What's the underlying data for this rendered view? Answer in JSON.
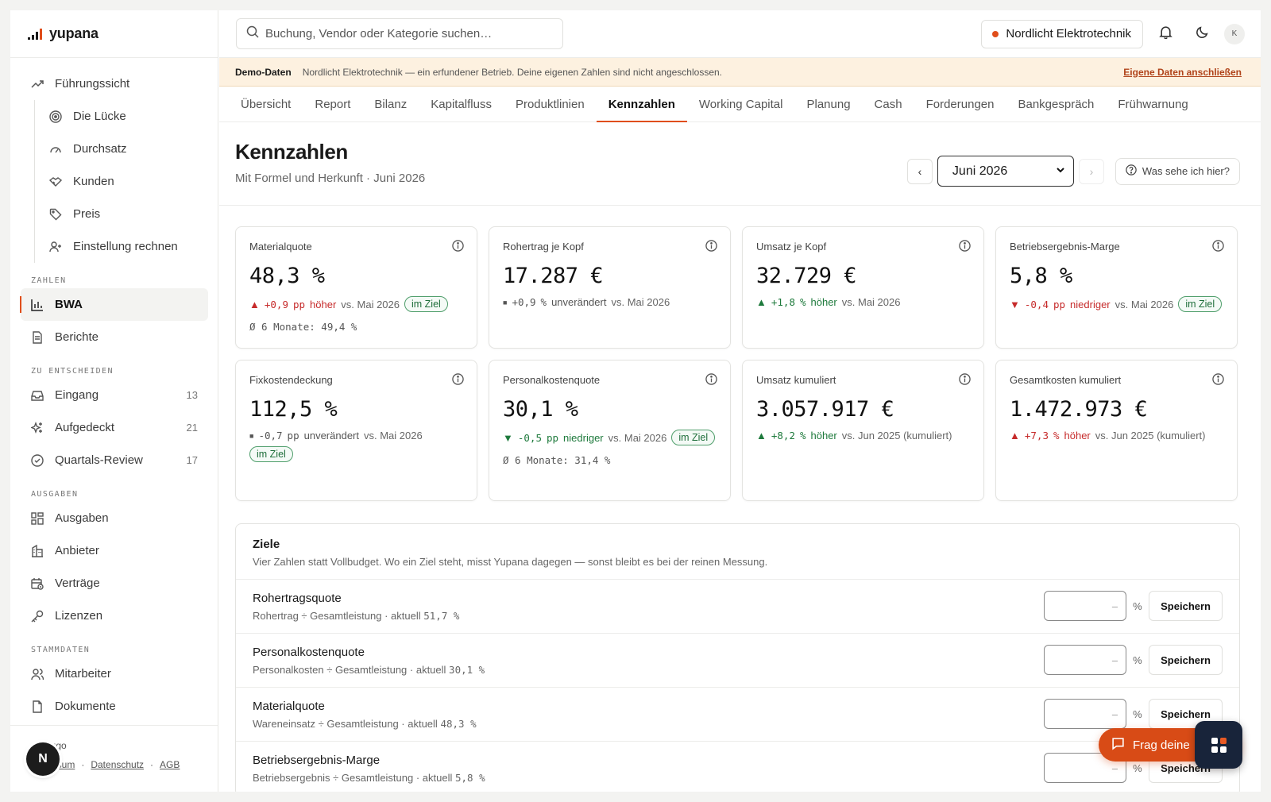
{
  "brand": {
    "name": "yupana"
  },
  "sidebar": {
    "items": [
      {
        "label": "Führungssicht",
        "icon": "trend-up-icon"
      },
      {
        "label": "Die Lücke",
        "icon": "target-icon"
      },
      {
        "label": "Durchsatz",
        "icon": "gauge-icon"
      },
      {
        "label": "Kunden",
        "icon": "handshake-icon"
      },
      {
        "label": "Preis",
        "icon": "tag-icon"
      },
      {
        "label": "Einstellung rechnen",
        "icon": "user-plus-icon"
      },
      {
        "label": "BWA",
        "icon": "bar-chart-icon"
      },
      {
        "label": "Berichte",
        "icon": "document-icon"
      },
      {
        "label": "Eingang",
        "icon": "inbox-icon",
        "count": "13"
      },
      {
        "label": "Aufgedeckt",
        "icon": "sparkles-icon",
        "count": "21"
      },
      {
        "label": "Quartals-Review",
        "icon": "check-circle-icon",
        "count": "17"
      },
      {
        "label": "Ausgaben",
        "icon": "grid-icon"
      },
      {
        "label": "Anbieter",
        "icon": "building-icon"
      },
      {
        "label": "Verträge",
        "icon": "calendar-clock-icon"
      },
      {
        "label": "Lizenzen",
        "icon": "key-icon"
      },
      {
        "label": "Mitarbeiter",
        "icon": "users-icon"
      },
      {
        "label": "Dokumente",
        "icon": "file-icon"
      }
    ],
    "sections": {
      "zahlen": "ZAHLEN",
      "entscheiden": "ZU ENTSCHEIDEN",
      "ausgaben": "AUSGABEN",
      "stammdaten": "STAMMDATEN"
    },
    "footer": {
      "domain": "g.hugo",
      "impressum": "Impressum",
      "datenschutz": "Datenschutz",
      "agb": "AGB",
      "sep": "·"
    },
    "avatar_letter": "N"
  },
  "topbar": {
    "search_placeholder": "Buchung, Vendor oder Kategorie suchen…",
    "company": "Nordlicht Elektrotechnik",
    "user_initial": "K"
  },
  "demo_banner": {
    "label": "Demo-Daten",
    "text": "Nordlicht Elektrotechnik — ein erfundener Betrieb. Deine eigenen Zahlen sind nicht angeschlossen.",
    "link": "Eigene Daten anschließen"
  },
  "tabs": [
    "Übersicht",
    "Report",
    "Bilanz",
    "Kapitalfluss",
    "Produktlinien",
    "Kennzahlen",
    "Working Capital",
    "Planung",
    "Cash",
    "Forderungen",
    "Bankgespräch",
    "Frühwarnung"
  ],
  "page": {
    "title": "Kennzahlen",
    "subtitle": "Mit Formel und Herkunft · Juni 2026",
    "period": "Juni 2026",
    "help": "Was sehe ich hier?"
  },
  "kpis": [
    {
      "label": "Materialquote",
      "value": "48,3 %",
      "arrow": "▲",
      "delta": "+0,9",
      "unit": "pp",
      "dir": "höher",
      "vs": "vs. Mai 2026",
      "badge": "im Ziel",
      "avg": "Ø 6 Monate: 49,4 %"
    },
    {
      "label": "Rohertrag je Kopf",
      "value": "17.287 €",
      "arrow": "■",
      "delta": "+0,9",
      "unit": "%",
      "dir": "unverändert",
      "vs": "vs. Mai 2026"
    },
    {
      "label": "Umsatz je Kopf",
      "value": "32.729 €",
      "arrow": "▲",
      "delta": "+1,8",
      "unit": "%",
      "dir": "höher",
      "vs": "vs. Mai 2026"
    },
    {
      "label": "Betriebsergebnis-Marge",
      "value": "5,8 %",
      "arrow": "▼",
      "delta": "-0,4",
      "unit": "pp",
      "dir": "niedriger",
      "vs": "vs. Mai 2026",
      "badge": "im Ziel"
    },
    {
      "label": "Fixkostendeckung",
      "value": "112,5 %",
      "arrow": "■",
      "delta": "-0,7",
      "unit": "pp",
      "dir": "unverändert",
      "vs": "vs. Mai 2026",
      "badge": "im Ziel"
    },
    {
      "label": "Personalkostenquote",
      "value": "30,1 %",
      "arrow": "▼",
      "delta": "-0,5",
      "unit": "pp",
      "dir": "niedriger",
      "vs": "vs. Mai 2026",
      "badge": "im Ziel",
      "avg": "Ø 6 Monate: 31,4 %"
    },
    {
      "label": "Umsatz kumuliert",
      "value": "3.057.917 €",
      "arrow": "▲",
      "delta": "+8,2",
      "unit": "%",
      "dir": "höher",
      "vs": "vs. Jun 2025 (kumuliert)"
    },
    {
      "label": "Gesamtkosten kumuliert",
      "value": "1.472.973 €",
      "arrow": "▲",
      "delta": "+7,3",
      "unit": "%",
      "dir": "höher",
      "vs": "vs. Jun 2025 (kumuliert)"
    }
  ],
  "goals": {
    "title": "Ziele",
    "subtitle": "Vier Zahlen statt Vollbudget. Wo ein Ziel steht, misst Yupana dagegen — sonst bleibt es bei der reinen Messung.",
    "input_placeholder": "–",
    "pct": "%",
    "save": "Speichern",
    "rows": [
      {
        "name": "Rohertragsquote",
        "formula": "Rohertrag ÷ Gesamtleistung · aktuell",
        "current": "51,7 %"
      },
      {
        "name": "Personalkostenquote",
        "formula": "Personalkosten ÷ Gesamtleistung · aktuell",
        "current": "30,1 %"
      },
      {
        "name": "Materialquote",
        "formula": "Wareneinsatz ÷ Gesamtleistung · aktuell",
        "current": "48,3 %"
      },
      {
        "name": "Betriebsergebnis-Marge",
        "formula": "Betriebsergebnis ÷ Gesamtleistung · aktuell",
        "current": "5,8 %"
      }
    ]
  },
  "assistant": {
    "label": "Frag deine"
  },
  "colors": {
    "accent": "#e04e1b",
    "positive": "#1e7a3c",
    "negative": "#c62b2b",
    "banner": "#fdf1e0"
  }
}
